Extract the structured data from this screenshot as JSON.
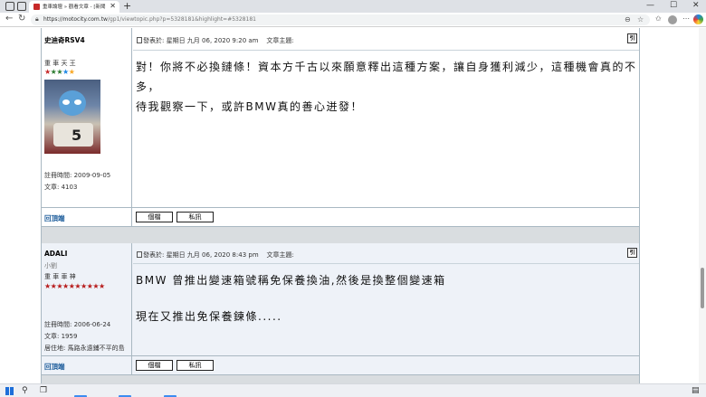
{
  "browser": {
    "tab_title": "重車論壇 » 觀看文章 - [新聞]BMW",
    "tab_close": "✕",
    "new_tab": "+",
    "url_host": "https://motocity.com.tw",
    "url_path": "/gp1/viewtopic.php?p=5328181&highlight=#5328181",
    "min": "—",
    "max": "☐",
    "close": "✕"
  },
  "posts": [
    {
      "username": "史迪奇RSV4",
      "rank": "重 車 天 王",
      "stars": [
        "★",
        "★",
        "★",
        "★",
        "★"
      ],
      "star_colors": [
        "#c62828",
        "#2e7d32",
        "#2e7d32",
        "#1e88e5",
        "#f9a825"
      ],
      "joined": "註冊時間: 2009-09-05",
      "post_count": "文章: 4103",
      "post_time": "發表於: 星期日 九月 06, 2020 9:20 am",
      "subject_label": "文章主題:",
      "body_lines": [
        "對！你將不必換鏈條！資本方千古以來願意釋出這種方案，讓自身獲利減少，這種機會真的不多，",
        "待我觀察一下，或許BMW真的善心迸發！"
      ]
    },
    {
      "username": "ADALI",
      "nickname": "小劉",
      "rank": "重 車 車 神",
      "stars": [
        "★",
        "★",
        "★",
        "★",
        "★",
        "★",
        "★",
        "★",
        "★",
        "★"
      ],
      "star_color": "#b71c1c",
      "joined": "註冊時間: 2006-06-24",
      "post_count": "文章: 1959",
      "location": "居住地: 馬路永遠鋪不平的島",
      "post_time": "發表於: 星期日 九月 06, 2020 8:43 pm",
      "subject_label": "文章主題:",
      "body_lines": [
        "BMW 曾推出變速箱號稱免保養換油,然後是換整個變速箱",
        "",
        "現在又推出免保養鍊條....."
      ]
    }
  ],
  "actions": {
    "back_to_top": "回頂端",
    "profile": "個檔",
    "pm": "私訊",
    "quote": "引"
  }
}
